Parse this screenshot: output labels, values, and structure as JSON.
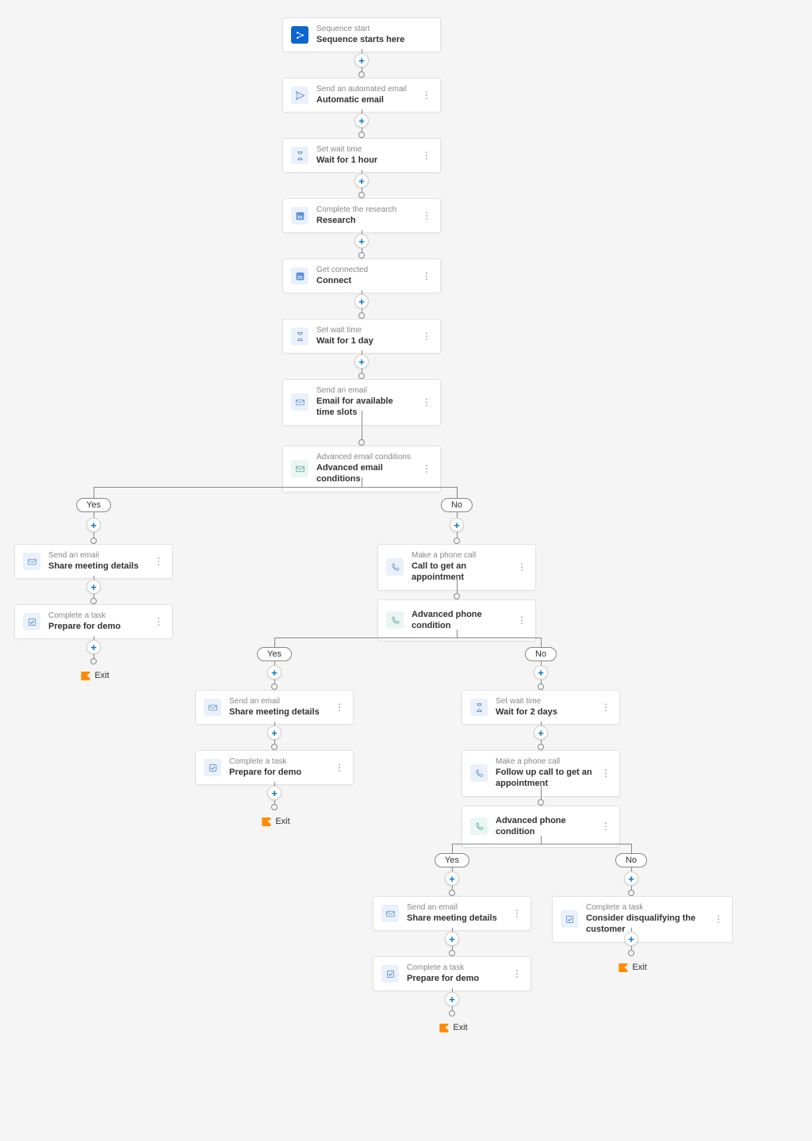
{
  "labels": {
    "yes": "Yes",
    "no": "No",
    "exit": "Exit"
  },
  "nodes": {
    "n1": {
      "label": "Sequence start",
      "title": "Sequence starts here"
    },
    "n2": {
      "label": "Send an automated email",
      "title": "Automatic email"
    },
    "n3": {
      "label": "Set wait time",
      "title": "Wait for 1 hour"
    },
    "n4": {
      "label": "Complete the research",
      "title": "Research"
    },
    "n5": {
      "label": "Get connected",
      "title": "Connect"
    },
    "n6": {
      "label": "Set wait time",
      "title": "Wait for 1 day"
    },
    "n7": {
      "label": "Send an email",
      "title": "Email for available time slots"
    },
    "n8": {
      "label": "Advanced email conditions",
      "title": "Advanced email conditions"
    },
    "n9": {
      "label": "Send an email",
      "title": "Share meeting details"
    },
    "n10": {
      "label": "Complete a task",
      "title": "Prepare for demo"
    },
    "n11": {
      "label": "Make a phone call",
      "title": "Call to get an appointment"
    },
    "n12": {
      "label": "",
      "title": "Advanced phone condition"
    },
    "n13": {
      "label": "Send an email",
      "title": "Share meeting details"
    },
    "n14": {
      "label": "Complete a task",
      "title": "Prepare for demo"
    },
    "n15": {
      "label": "Set wait time",
      "title": "Wait for 2 days"
    },
    "n16": {
      "label": "Make a phone call",
      "title": "Follow up call to get an appointment"
    },
    "n17": {
      "label": "",
      "title": "Advanced phone condition"
    },
    "n18": {
      "label": "Send an email",
      "title": "Share meeting details"
    },
    "n19": {
      "label": "Complete a task",
      "title": "Prepare for demo"
    },
    "n20": {
      "label": "Complete a task",
      "title": "Consider disqualifying the customer"
    }
  }
}
